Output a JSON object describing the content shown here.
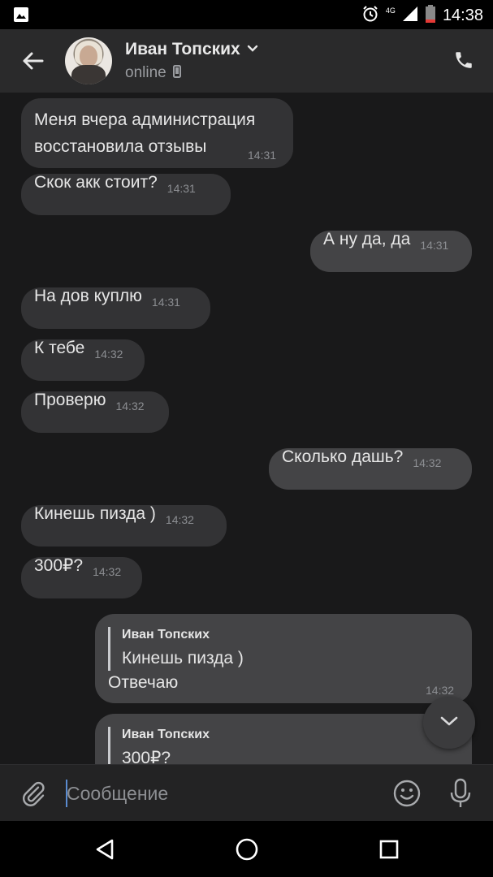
{
  "status_bar": {
    "time": "14:38",
    "network": "4G",
    "icons": [
      "image-icon",
      "alarm-icon",
      "signal-icon",
      "battery-icon"
    ]
  },
  "header": {
    "contact_name": "Иван Топских",
    "presence": "online",
    "icons": [
      "back-arrow-icon",
      "chevron-down-icon",
      "mobile-icon",
      "phone-icon"
    ]
  },
  "messages": [
    {
      "direction": "in",
      "text": "Меня вчера администрация\nвосстановила отзывы",
      "time": "14:31"
    },
    {
      "direction": "in",
      "text": "Скок акк стоит?",
      "time": "14:31"
    },
    {
      "direction": "out",
      "text": "А ну да, да",
      "time": "14:31"
    },
    {
      "direction": "in",
      "text": "На дов куплю",
      "time": "14:31"
    },
    {
      "direction": "in",
      "text": "К тебе",
      "time": "14:32"
    },
    {
      "direction": "in",
      "text": "Проверю",
      "time": "14:32"
    },
    {
      "direction": "out",
      "text": "Сколько дашь?",
      "time": "14:32"
    },
    {
      "direction": "in",
      "text": "Кинешь пизда )",
      "time": "14:32"
    },
    {
      "direction": "in",
      "text": "300₽?",
      "time": "14:32"
    },
    {
      "direction": "out",
      "reply_to": {
        "author": "Иван Топских",
        "text": "Кинешь пизда )"
      },
      "text": "Отвечаю",
      "time": "14:32"
    },
    {
      "direction": "out",
      "reply_to": {
        "author": "Иван Топских",
        "text": "300₽?"
      },
      "text": "",
      "time": ""
    }
  ],
  "composer": {
    "placeholder": "Сообщение",
    "icons": [
      "paperclip-icon",
      "emoji-icon",
      "microphone-icon"
    ]
  },
  "nav_bar": {
    "icons": [
      "back-triangle-icon",
      "home-circle-icon",
      "recents-square-icon"
    ]
  },
  "colors": {
    "background": "#19191a",
    "header": "#2a2a2b",
    "incoming_bubble": "#333335",
    "outgoing_bubble": "#444446",
    "caret": "#5a8bd0"
  }
}
